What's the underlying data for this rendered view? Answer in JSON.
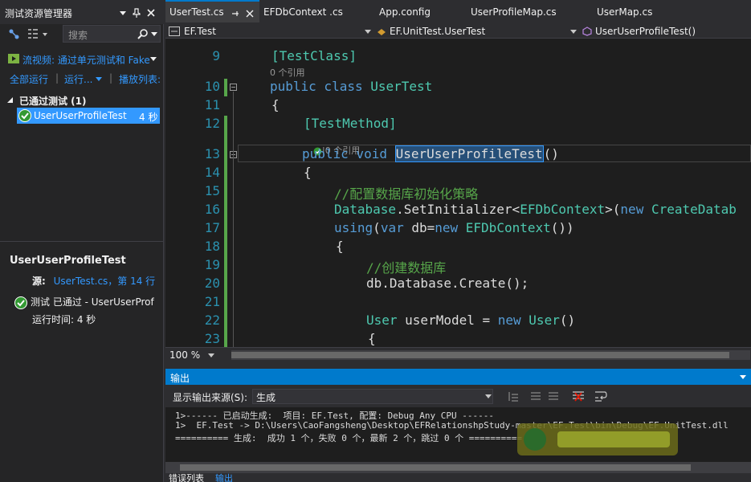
{
  "test_explorer": {
    "title": "测试资源管理器",
    "search_placeholder": "搜索",
    "playlist": "流视频: 通过单元测试和 Fake",
    "links": {
      "run_all": "全部运行",
      "run": "运行...",
      "playlist": "播放列表:"
    },
    "group": "已通过测试 (1)",
    "test_name": "UserUserProfileTest",
    "test_time": "4 秒",
    "detail": {
      "title": "UserUserProfileTest",
      "source_label": "源:",
      "source_link": "UserTest.cs，第 14 行",
      "passed": "测试 已通过 - UserUserProf",
      "runtime": "运行时间: 4 秒"
    }
  },
  "tabs": [
    "UserTest.cs",
    "EFDbContext .cs",
    "App.config",
    "UserProfileMap.cs",
    "UserMap.cs"
  ],
  "nav": {
    "project": "EF.Test",
    "class": "EF.UnitTest.UserTest",
    "member": "UserUserProfileTest()"
  },
  "editor": {
    "lines": [
      "9",
      "10",
      "11",
      "12",
      "13",
      "14",
      "15",
      "16",
      "17",
      "18",
      "19",
      "20",
      "21",
      "22",
      "23"
    ],
    "lens1": "0 个引用",
    "lens2": "|0 个引用",
    "code": {
      "l9": "[TestClass]",
      "l10a": "public class ",
      "l10b": "UserTest",
      "l11": "{",
      "l12": "[TestMethod]",
      "l13a": "public void ",
      "l13b": "UserUserProfileTest",
      "l13c": "()",
      "l14": "{",
      "l15": "//配置数据库初始化策略",
      "l16a": "Database",
      "l16b": ".SetInitializer<",
      "l16c": "EFDbContext",
      "l16d": ">(",
      "l16e": "new ",
      "l16f": "CreateDatab",
      "l17a": "using",
      "l17b": "(",
      "l17c": "var",
      "l17d": " db=",
      "l17e": "new ",
      "l17f": "EFDbContext",
      "l17g": "())",
      "l18": "{",
      "l19": "//创建数据库",
      "l20": "db.Database.Create();",
      "l22a": "User",
      "l22b": " userModel = ",
      "l22c": "new ",
      "l22d": "User",
      "l22e": "()",
      "l23": "{"
    }
  },
  "zoom": "100 %",
  "output": {
    "title": "输出",
    "source_label": "显示输出来源(S):",
    "source_value": "生成",
    "lines": [
      "1>------ 已启动生成:  项目: EF.Test, 配置: Debug Any CPU ------",
      "1>  EF.Test -> D:\\Users\\CaoFangsheng\\Desktop\\EFRelationshpStudy-master\\EF.Test\\bin\\Debug\\EF.UnitTest.dll",
      "========== 生成:  成功 1 个，失败 0 个，最新 2 个，跳过 0 个 =========="
    ]
  },
  "bottom_tabs": [
    "错误列表",
    "输出"
  ],
  "colors": {
    "accent": "#007acc",
    "selection": "#3399ff",
    "pass": "#339933",
    "keyword": "#569cd6",
    "type": "#4ec9b0",
    "comment": "#57a64a"
  }
}
